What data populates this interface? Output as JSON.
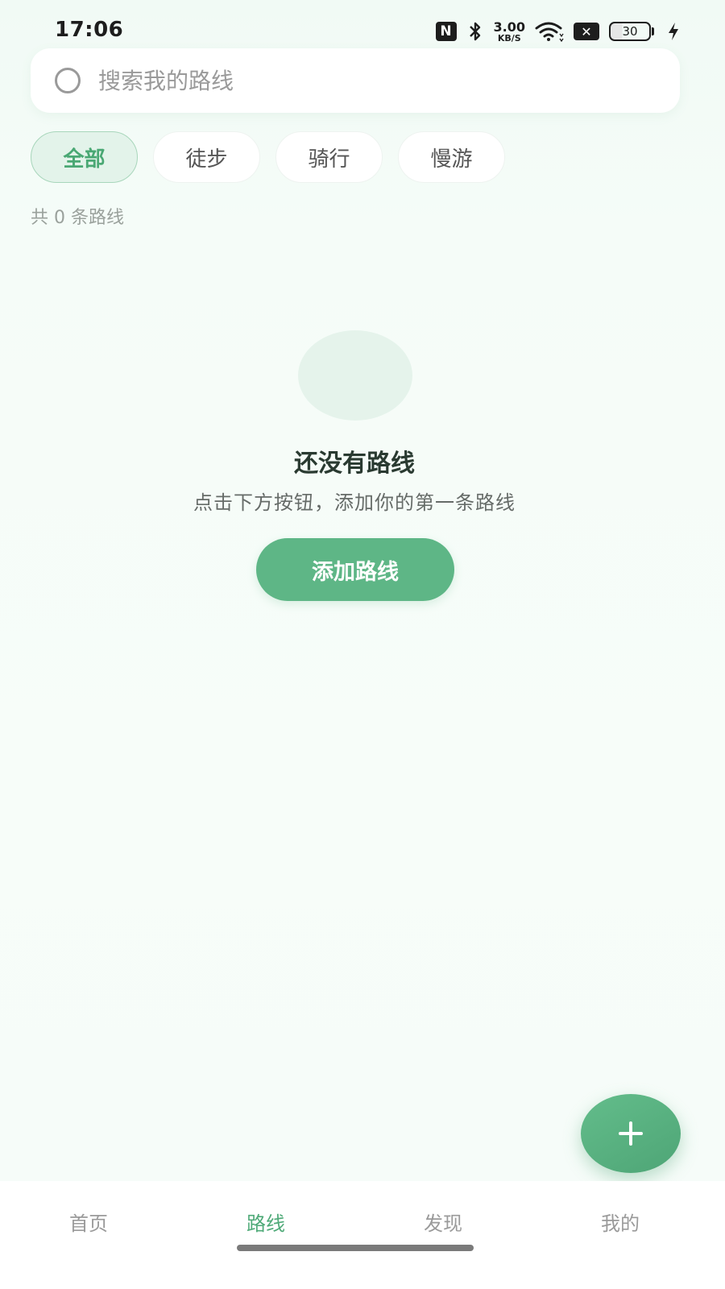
{
  "status_bar": {
    "time": "17:06",
    "nfc_label": "N",
    "speed_value": "3.00",
    "speed_unit": "KB/S",
    "sim_label": "✕",
    "battery_level": "30"
  },
  "search": {
    "placeholder": "搜索我的路线",
    "value": ""
  },
  "filters": [
    {
      "label": "全部",
      "active": true
    },
    {
      "label": "徒步",
      "active": false
    },
    {
      "label": "骑行",
      "active": false
    },
    {
      "label": "慢游",
      "active": false
    }
  ],
  "route_count_text": "共 0 条路线",
  "empty_state": {
    "title": "还没有路线",
    "description": "点击下方按钮，添加你的第一条路线",
    "button_label": "添加路线"
  },
  "fab_icon": "plus-icon",
  "bottom_nav": [
    {
      "label": "首页",
      "active": false
    },
    {
      "label": "路线",
      "active": true
    },
    {
      "label": "发现",
      "active": false
    },
    {
      "label": "我的",
      "active": false
    }
  ],
  "colors": {
    "accent": "#5eb686",
    "accent_text": "#4faa78",
    "background": "#f5fcf8"
  }
}
